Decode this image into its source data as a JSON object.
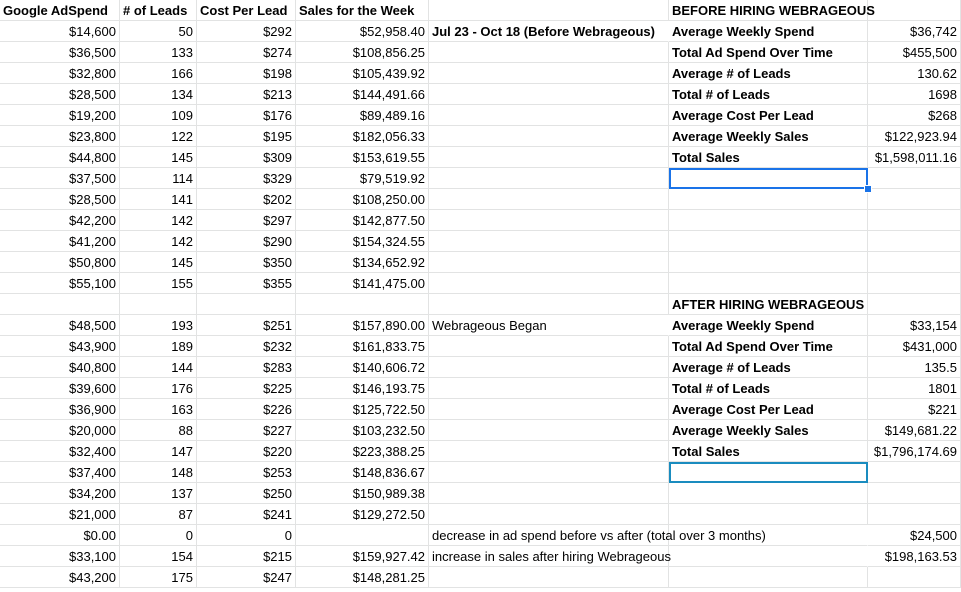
{
  "headers": [
    "Google AdSpend",
    "# of Leads",
    "Cost Per Lead",
    "Sales for the Week"
  ],
  "rows": [
    {
      "spend": "$14,600",
      "leads": "50",
      "cpl": "$292",
      "sales": "$52,958.40",
      "note": "Jul 23 - Oct 18 (Before Webrageous)",
      "note_bold": true
    },
    {
      "spend": "$36,500",
      "leads": "133",
      "cpl": "$274",
      "sales": "$108,856.25"
    },
    {
      "spend": "$32,800",
      "leads": "166",
      "cpl": "$198",
      "sales": "$105,439.92"
    },
    {
      "spend": "$28,500",
      "leads": "134",
      "cpl": "$213",
      "sales": "$144,491.66"
    },
    {
      "spend": "$19,200",
      "leads": "109",
      "cpl": "$176",
      "sales": "$89,489.16"
    },
    {
      "spend": "$23,800",
      "leads": "122",
      "cpl": "$195",
      "sales": "$182,056.33"
    },
    {
      "spend": "$44,800",
      "leads": "145",
      "cpl": "$309",
      "sales": "$153,619.55"
    },
    {
      "spend": "$37,500",
      "leads": "114",
      "cpl": "$329",
      "sales": "$79,519.92"
    },
    {
      "spend": "$28,500",
      "leads": "141",
      "cpl": "$202",
      "sales": "$108,250.00"
    },
    {
      "spend": "$42,200",
      "leads": "142",
      "cpl": "$297",
      "sales": "$142,877.50"
    },
    {
      "spend": "$41,200",
      "leads": "142",
      "cpl": "$290",
      "sales": "$154,324.55"
    },
    {
      "spend": "$50,800",
      "leads": "145",
      "cpl": "$350",
      "sales": "$134,652.92"
    },
    {
      "spend": "$55,100",
      "leads": "155",
      "cpl": "$355",
      "sales": "$141,475.00"
    },
    {
      "spend": "",
      "leads": "",
      "cpl": "",
      "sales": ""
    },
    {
      "spend": "$48,500",
      "leads": "193",
      "cpl": "$251",
      "sales": "$157,890.00",
      "note": "Webrageous Began"
    },
    {
      "spend": "$43,900",
      "leads": "189",
      "cpl": "$232",
      "sales": "$161,833.75"
    },
    {
      "spend": "$40,800",
      "leads": "144",
      "cpl": "$283",
      "sales": "$140,606.72"
    },
    {
      "spend": "$39,600",
      "leads": "176",
      "cpl": "$225",
      "sales": "$146,193.75"
    },
    {
      "spend": "$36,900",
      "leads": "163",
      "cpl": "$226",
      "sales": "$125,722.50"
    },
    {
      "spend": "$20,000",
      "leads": "88",
      "cpl": "$227",
      "sales": "$103,232.50"
    },
    {
      "spend": "$32,400",
      "leads": "147",
      "cpl": "$220",
      "sales": "$223,388.25"
    },
    {
      "spend": "$37,400",
      "leads": "148",
      "cpl": "$253",
      "sales": "$148,836.67"
    },
    {
      "spend": "$34,200",
      "leads": "137",
      "cpl": "$250",
      "sales": "$150,989.38"
    },
    {
      "spend": "$21,000",
      "leads": "87",
      "cpl": "$241",
      "sales": "$129,272.50"
    },
    {
      "spend": "$0.00",
      "leads": "0",
      "cpl": "0",
      "sales": ""
    },
    {
      "spend": "$33,100",
      "leads": "154",
      "cpl": "$215",
      "sales": "$159,927.42"
    },
    {
      "spend": "$43,200",
      "leads": "175",
      "cpl": "$247",
      "sales": "$148,281.25"
    }
  ],
  "before": {
    "title": "BEFORE HIRING WEBRAGEOUS",
    "stats": [
      {
        "label": "Average Weekly Spend",
        "value": "$36,742"
      },
      {
        "label": "Total Ad Spend Over Time",
        "value": "$455,500"
      },
      {
        "label": "Average # of Leads",
        "value": "130.62"
      },
      {
        "label": "Total # of Leads",
        "value": "1698"
      },
      {
        "label": "Average Cost Per Lead",
        "value": "$268"
      },
      {
        "label": "Average Weekly Sales",
        "value": "$122,923.94"
      },
      {
        "label": "Total Sales",
        "value": "$1,598,011.16"
      }
    ]
  },
  "after": {
    "title": "AFTER HIRING WEBRAGEOUS",
    "stats": [
      {
        "label": "Average Weekly Spend",
        "value": "$33,154"
      },
      {
        "label": "Total Ad Spend Over Time",
        "value": "$431,000"
      },
      {
        "label": "Average # of Leads",
        "value": "135.5"
      },
      {
        "label": "Total # of Leads",
        "value": "1801"
      },
      {
        "label": "Average Cost Per Lead",
        "value": "$221"
      },
      {
        "label": "Average Weekly Sales",
        "value": "$149,681.22"
      },
      {
        "label": "Total Sales",
        "value": "$1,796,174.69"
      }
    ]
  },
  "comparisons": [
    {
      "label": "decrease in ad spend before vs after (total over 3 months)",
      "value": "$24,500"
    },
    {
      "label": "increase in sales after hiring Webrageous",
      "value": "$198,163.53"
    }
  ],
  "colors": {
    "gridline": "#e2e3e3",
    "selection": "#1a73e8",
    "selection_alt": "#1a8cbf"
  }
}
